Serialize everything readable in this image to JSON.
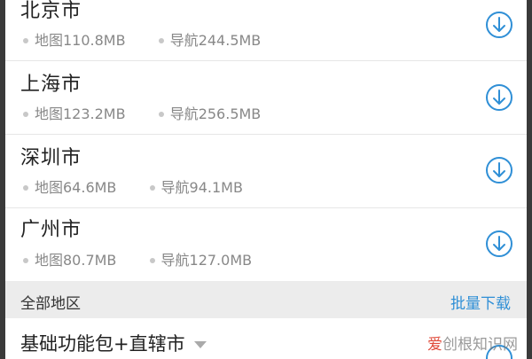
{
  "cities": [
    {
      "name": "北京市",
      "map": "地图110.8MB",
      "nav": "导航244.5MB"
    },
    {
      "name": "上海市",
      "map": "地图123.2MB",
      "nav": "导航256.5MB"
    },
    {
      "name": "深圳市",
      "map": "地图64.6MB",
      "nav": "导航94.1MB"
    },
    {
      "name": "广州市",
      "map": "地图80.7MB",
      "nav": "导航127.0MB"
    }
  ],
  "section": {
    "title": "全部地区",
    "batch_download": "批量下载"
  },
  "package": {
    "name": "基础功能包+直辖市"
  },
  "watermark": {
    "brand": "爱",
    "rest": "创根知识网"
  },
  "colors": {
    "accent": "#2f8fd6"
  },
  "icons": {
    "download": "circle-arrow-down-icon",
    "expand": "caret-down-icon"
  }
}
